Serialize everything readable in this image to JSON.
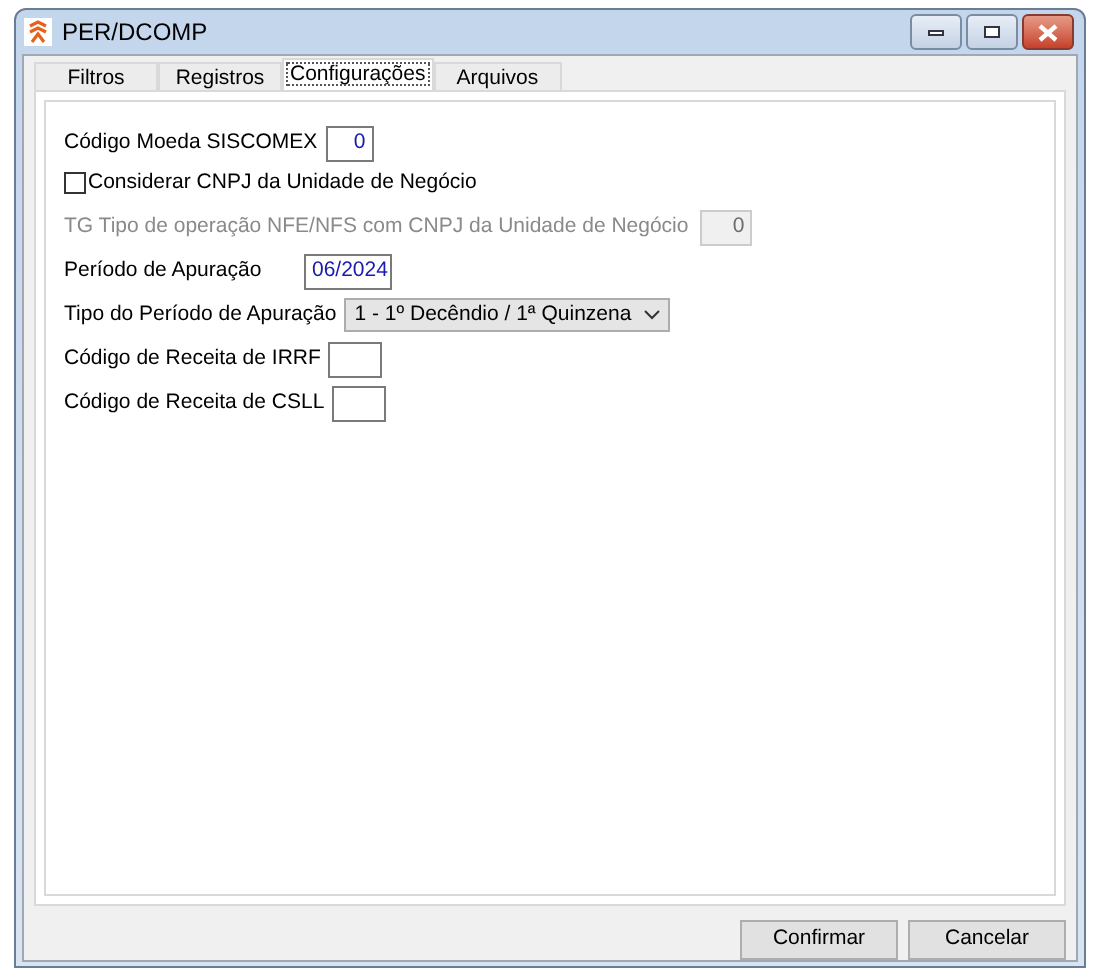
{
  "window": {
    "title": "PER/DCOMP"
  },
  "tabs": [
    {
      "label": "Filtros",
      "selected": false
    },
    {
      "label": "Registros",
      "selected": false
    },
    {
      "label": "Configurações",
      "selected": true
    },
    {
      "label": "Arquivos",
      "selected": false
    }
  ],
  "fields": [
    {
      "kind": "text",
      "label": "Código Moeda SISCOMEX",
      "value": "0",
      "disabled": false
    },
    {
      "kind": "checkbox",
      "label": "Considerar CNPJ da Unidade de Negócio",
      "checked": false
    },
    {
      "kind": "text",
      "label": "TG Tipo de operação NFE/NFS com CNPJ da Unidade de Negócio",
      "value": "0",
      "disabled": true
    },
    {
      "kind": "text",
      "label": "Período de Apuração",
      "value": "06/2024",
      "disabled": false
    },
    {
      "kind": "select",
      "label": "Tipo do Período de Apuração",
      "value": "1 - 1º Decêndio / 1ª Quinzena"
    },
    {
      "kind": "text",
      "label": "Código de Receita de IRRF",
      "disabled": false
    },
    {
      "kind": "text",
      "label": "Código de Receita de CSLL",
      "disabled": false
    }
  ],
  "buttons": [
    "Confirmar",
    "Cancelar"
  ]
}
